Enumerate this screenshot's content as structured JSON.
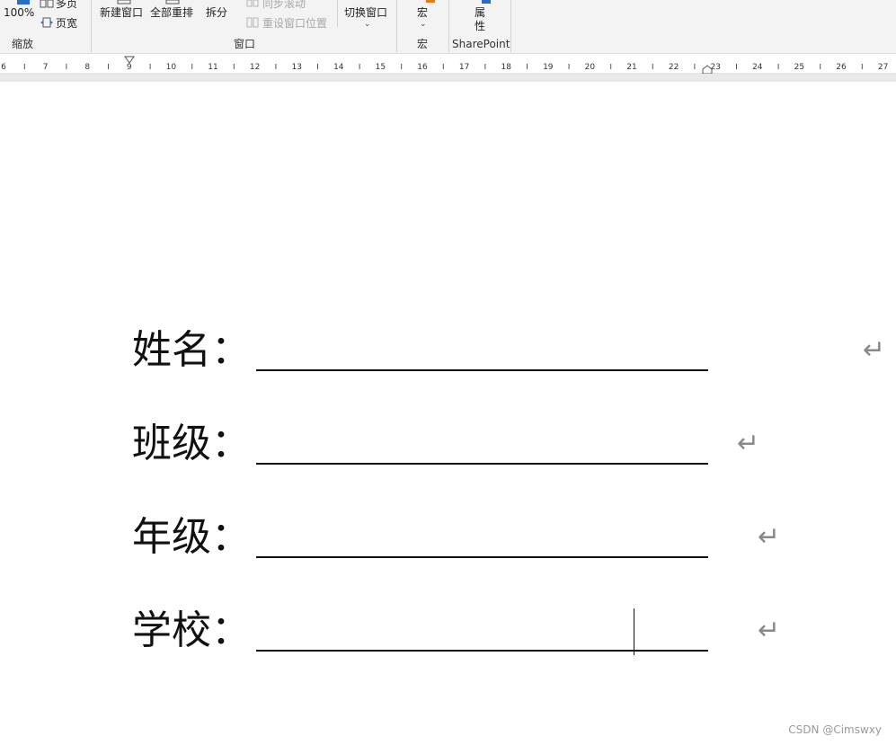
{
  "ribbon": {
    "zoom_group": {
      "zoom_100": "100%",
      "multi_page": "多页",
      "page_width": "页宽",
      "label": "缩放"
    },
    "window_group": {
      "new_window": "新建窗口",
      "arrange_all": "全部重排",
      "split": "拆分",
      "sync_scroll": "同步滚动",
      "reset_position": "重设窗口位置",
      "switch_windows": "切换窗口",
      "label": "窗口"
    },
    "macro_group": {
      "macros": "宏",
      "label": "宏"
    },
    "sharepoint_group": {
      "properties": "属性",
      "label": "SharePoint"
    }
  },
  "ruler": {
    "numbers": [
      "6",
      "7",
      "8",
      "9",
      "10",
      "11",
      "12",
      "13",
      "14",
      "15",
      "16",
      "17",
      "18",
      "19",
      "20",
      "21",
      "22",
      "23",
      "24",
      "25",
      "26",
      "27"
    ]
  },
  "document": {
    "fields": [
      {
        "label": "姓名："
      },
      {
        "label": "班级："
      },
      {
        "label": "年级："
      },
      {
        "label": "学校："
      }
    ],
    "paragraph_mark": "↵"
  },
  "watermark": "CSDN @Cimswxy",
  "colors": {
    "ribbon_bg": "#f3f3f3",
    "text": "#111111",
    "disabled": "#a8a8a8",
    "paragraph_mark": "#8a8a8a"
  }
}
